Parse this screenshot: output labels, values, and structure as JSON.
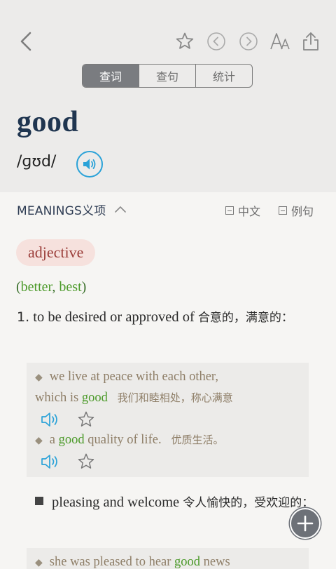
{
  "toolbar": {
    "back_icon": "chevron-left-icon",
    "icons": [
      "star-icon",
      "prev-circle-icon",
      "next-circle-icon",
      "font-size-icon",
      "share-icon"
    ]
  },
  "tabs": [
    {
      "label": "查词",
      "active": true
    },
    {
      "label": "查句",
      "active": false
    },
    {
      "label": "统计",
      "active": false
    }
  ],
  "entry": {
    "word": "good",
    "phonetic": "/ɡʊd/"
  },
  "meanings": {
    "title": "MEANINGS义项",
    "option_chinese": "中文",
    "option_examples": "例句"
  },
  "pos": "adjective",
  "forms": {
    "open": "(",
    "comparative": "better",
    "sep": ", ",
    "superlative": "best",
    "close": ")"
  },
  "sense1": {
    "number": "1.",
    "text_en": "to be desired or approved of",
    "text_zh": "合意的，满意的："
  },
  "examples1": [
    {
      "pre": "we live at peace with each other,",
      "line2_pre": "which is ",
      "keyword": "good",
      "post": "",
      "zh": "我们和睦相处，称心满意"
    },
    {
      "pre": "a ",
      "keyword": "good",
      "post": " quality of life.",
      "zh": "优质生活。"
    }
  ],
  "sense2": {
    "text_en": "pleasing and welcome",
    "text_zh": "令人愉快的，受欢迎的："
  },
  "example2_partial": {
    "pre": "she was pleased to hear ",
    "keyword": "good",
    "post": " news"
  },
  "colors": {
    "word": "#1f3550",
    "pos_text": "#9b3d39",
    "pos_bg": "#f6e1dd",
    "keyword_green": "#4c9a2a",
    "speaker_blue": "#2aa2d8",
    "example_text": "#8e7e67"
  }
}
